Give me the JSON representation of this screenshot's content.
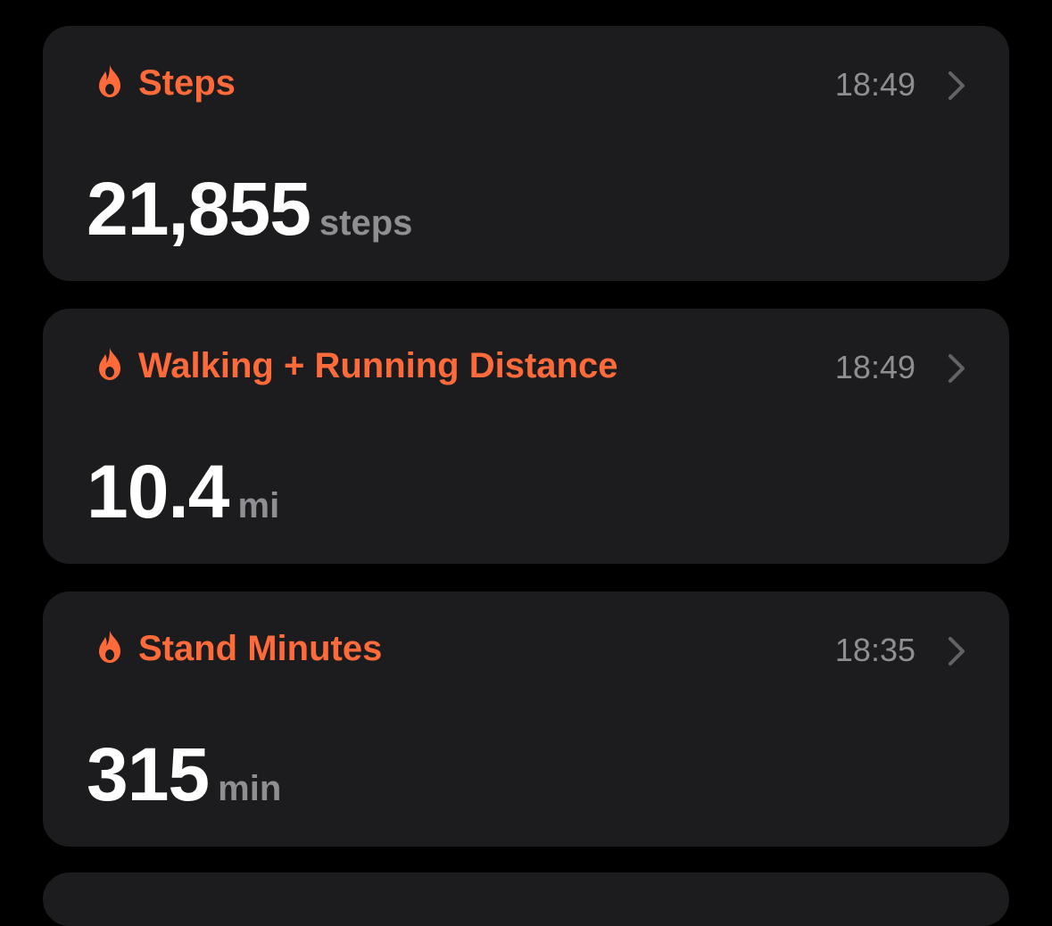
{
  "accent_color": "#ff6a3a",
  "cards": [
    {
      "title": "Steps",
      "time": "18:49",
      "value": "21,855",
      "unit": "steps",
      "icon": "flame-icon"
    },
    {
      "title": "Walking + Running Distance",
      "time": "18:49",
      "value": "10.4",
      "unit": "mi",
      "icon": "flame-icon"
    },
    {
      "title": "Stand Minutes",
      "time": "18:35",
      "value": "315",
      "unit": "min",
      "icon": "flame-icon"
    }
  ]
}
